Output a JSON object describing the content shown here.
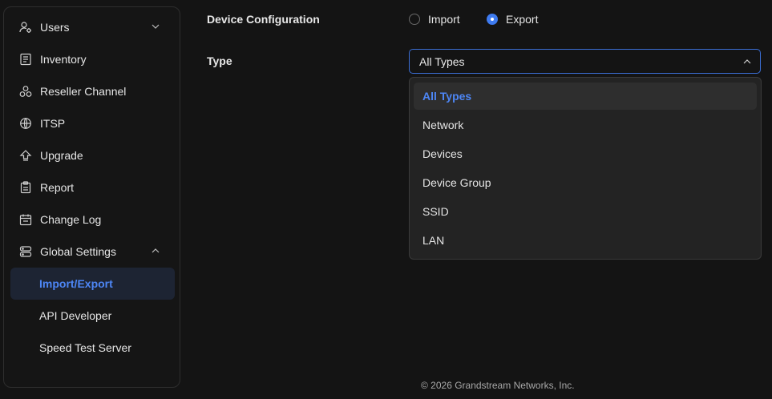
{
  "sidebar": {
    "items": [
      {
        "label": "Users",
        "icon": "users-gear-icon"
      },
      {
        "label": "Inventory",
        "icon": "inventory-icon"
      },
      {
        "label": "Reseller Channel",
        "icon": "reseller-channel-icon"
      },
      {
        "label": "ITSP",
        "icon": "globe-icon"
      },
      {
        "label": "Upgrade",
        "icon": "upgrade-arrow-icon"
      },
      {
        "label": "Report",
        "icon": "clipboard-icon"
      },
      {
        "label": "Change Log",
        "icon": "calendar-icon"
      },
      {
        "label": "Global Settings",
        "icon": "server-settings-icon"
      },
      {
        "label": "Import/Export"
      },
      {
        "label": "API Developer"
      },
      {
        "label": "Speed Test Server"
      }
    ],
    "active": "Import/Export"
  },
  "form": {
    "config_label": "Device Configuration",
    "radio_import": "Import",
    "radio_export": "Export",
    "selected_mode": "Export",
    "type_label": "Type",
    "type_value": "All Types"
  },
  "dropdown": {
    "options": [
      "All Types",
      "Network",
      "Devices",
      "Device Group",
      "SSID",
      "LAN"
    ],
    "selected": "All Types"
  },
  "footer": {
    "copyright": "© 2026 Grandstream Networks, Inc."
  },
  "colors": {
    "accent": "#3e7bf0",
    "background": "#141414",
    "active_bg": "#1d2433"
  }
}
